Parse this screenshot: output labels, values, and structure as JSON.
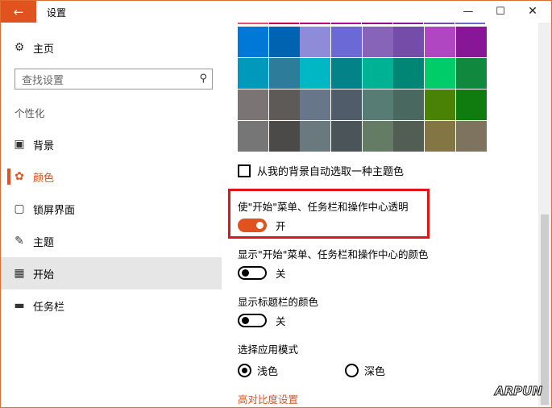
{
  "window": {
    "title": "设置"
  },
  "nav": {
    "home_label": "主页",
    "search_placeholder": "查找设置",
    "section_label": "个性化",
    "items": [
      {
        "label": "背景",
        "icon": "image-icon"
      },
      {
        "label": "颜色",
        "icon": "palette-icon",
        "active": true
      },
      {
        "label": "锁屏界面",
        "icon": "lock-screen-icon"
      },
      {
        "label": "主题",
        "icon": "theme-icon"
      },
      {
        "label": "开始",
        "icon": "start-icon",
        "selected": true
      },
      {
        "label": "任务栏",
        "icon": "taskbar-icon"
      }
    ]
  },
  "content": {
    "top_strip_colors": [
      "#e84f68",
      "#c30052",
      "#bf0077",
      "#b4009e",
      "#9a0089",
      "#881798",
      "#744da9",
      "#6b69d6"
    ],
    "swatch_rows": [
      [
        "#0078d7",
        "#0063b1",
        "#8e8cd8",
        "#6b69d6",
        "#8764b8",
        "#744da9",
        "#b146c2",
        "#881798"
      ],
      [
        "#0099bc",
        "#2d7d9a",
        "#00b7c3",
        "#038387",
        "#00b294",
        "#018574",
        "#00cc6a",
        "#10893e"
      ],
      [
        "#7a7574",
        "#5d5a58",
        "#68768a",
        "#515c6b",
        "#567c73",
        "#486860",
        "#498205",
        "#107c10"
      ],
      [
        "#767676",
        "#4c4a48",
        "#69797e",
        "#4a5459",
        "#647c64",
        "#525e54",
        "#847545",
        "#7e735f"
      ]
    ],
    "auto_color_label": "从我的背景自动选取一种主题色",
    "transparency": {
      "title": "使\"开始\"菜单、任务栏和操作中心透明",
      "state": "开"
    },
    "show_color": {
      "title": "显示\"开始\"菜单、任务栏和操作中心的颜色",
      "state": "关"
    },
    "titlebar_color": {
      "title": "显示标题栏的颜色",
      "state": "关"
    },
    "app_mode": {
      "title": "选择应用模式",
      "light": "浅色",
      "dark": "深色",
      "selected": "浅色"
    },
    "high_contrast_link": "高对比度设置"
  },
  "watermark": "ARPUN",
  "colors": {
    "accent": "#e0531f",
    "highlight_border": "#e01515"
  }
}
